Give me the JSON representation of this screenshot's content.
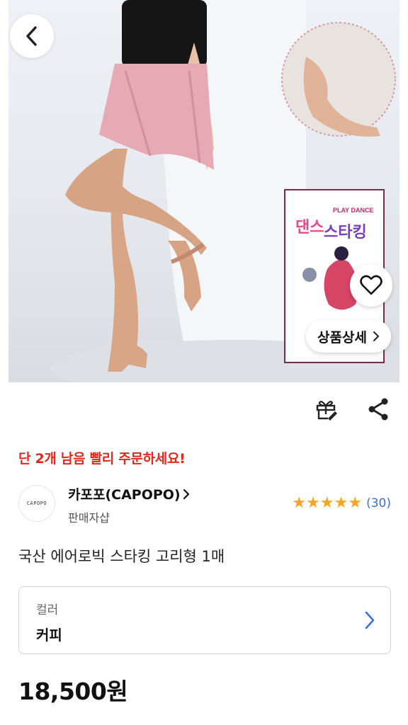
{
  "hero": {
    "detail_button_label": "상품상세",
    "inset_title": "댄스 스타킹",
    "inset_subtitle": "PLAY DANCE"
  },
  "stock": {
    "text": "단 2개 남음 빨리 주문하세요!",
    "color": "#e0291d"
  },
  "seller": {
    "logo_text": "CAPOPO",
    "name": "카포포(CAPOPO)",
    "subtitle": "판매자샵",
    "rating_stars": 5,
    "review_count": "(30)"
  },
  "product": {
    "title": "국산 에어로빅 스타킹 고리형 1매",
    "price": "18,500원"
  },
  "option": {
    "label": "컬러",
    "value": "커피"
  },
  "colors": {
    "accent_blue": "#3a6fd8",
    "star": "#f5a623",
    "warning_red": "#e0291d"
  },
  "icons": {
    "back": "chevron-left-icon",
    "wishlist": "heart-icon",
    "gift": "gift-icon",
    "share": "share-icon"
  }
}
